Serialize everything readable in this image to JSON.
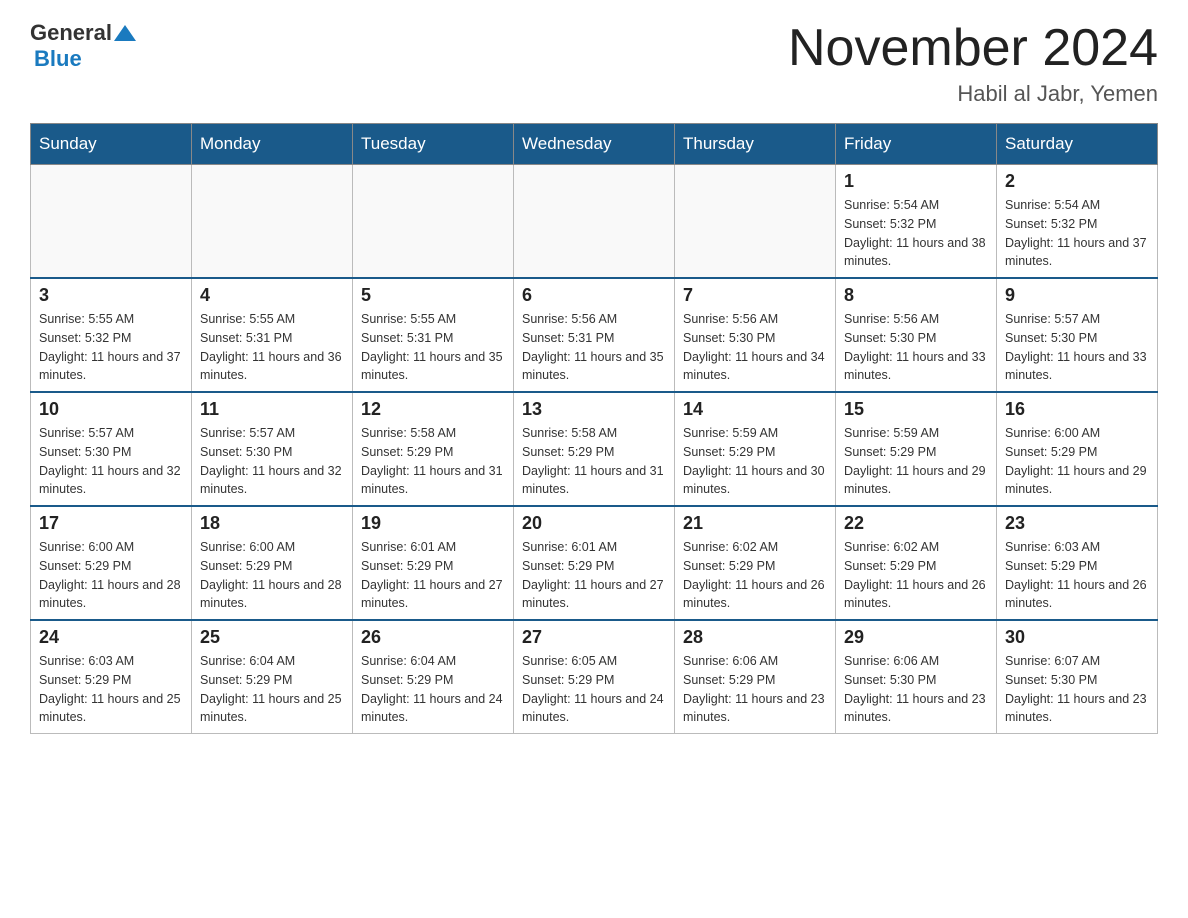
{
  "header": {
    "logo_general": "General",
    "logo_blue": "Blue",
    "month_title": "November 2024",
    "location": "Habil al Jabr, Yemen"
  },
  "weekdays": [
    "Sunday",
    "Monday",
    "Tuesday",
    "Wednesday",
    "Thursday",
    "Friday",
    "Saturday"
  ],
  "weeks": [
    [
      {
        "day": "",
        "sunrise": "",
        "sunset": "",
        "daylight": ""
      },
      {
        "day": "",
        "sunrise": "",
        "sunset": "",
        "daylight": ""
      },
      {
        "day": "",
        "sunrise": "",
        "sunset": "",
        "daylight": ""
      },
      {
        "day": "",
        "sunrise": "",
        "sunset": "",
        "daylight": ""
      },
      {
        "day": "",
        "sunrise": "",
        "sunset": "",
        "daylight": ""
      },
      {
        "day": "1",
        "sunrise": "Sunrise: 5:54 AM",
        "sunset": "Sunset: 5:32 PM",
        "daylight": "Daylight: 11 hours and 38 minutes."
      },
      {
        "day": "2",
        "sunrise": "Sunrise: 5:54 AM",
        "sunset": "Sunset: 5:32 PM",
        "daylight": "Daylight: 11 hours and 37 minutes."
      }
    ],
    [
      {
        "day": "3",
        "sunrise": "Sunrise: 5:55 AM",
        "sunset": "Sunset: 5:32 PM",
        "daylight": "Daylight: 11 hours and 37 minutes."
      },
      {
        "day": "4",
        "sunrise": "Sunrise: 5:55 AM",
        "sunset": "Sunset: 5:31 PM",
        "daylight": "Daylight: 11 hours and 36 minutes."
      },
      {
        "day": "5",
        "sunrise": "Sunrise: 5:55 AM",
        "sunset": "Sunset: 5:31 PM",
        "daylight": "Daylight: 11 hours and 35 minutes."
      },
      {
        "day": "6",
        "sunrise": "Sunrise: 5:56 AM",
        "sunset": "Sunset: 5:31 PM",
        "daylight": "Daylight: 11 hours and 35 minutes."
      },
      {
        "day": "7",
        "sunrise": "Sunrise: 5:56 AM",
        "sunset": "Sunset: 5:30 PM",
        "daylight": "Daylight: 11 hours and 34 minutes."
      },
      {
        "day": "8",
        "sunrise": "Sunrise: 5:56 AM",
        "sunset": "Sunset: 5:30 PM",
        "daylight": "Daylight: 11 hours and 33 minutes."
      },
      {
        "day": "9",
        "sunrise": "Sunrise: 5:57 AM",
        "sunset": "Sunset: 5:30 PM",
        "daylight": "Daylight: 11 hours and 33 minutes."
      }
    ],
    [
      {
        "day": "10",
        "sunrise": "Sunrise: 5:57 AM",
        "sunset": "Sunset: 5:30 PM",
        "daylight": "Daylight: 11 hours and 32 minutes."
      },
      {
        "day": "11",
        "sunrise": "Sunrise: 5:57 AM",
        "sunset": "Sunset: 5:30 PM",
        "daylight": "Daylight: 11 hours and 32 minutes."
      },
      {
        "day": "12",
        "sunrise": "Sunrise: 5:58 AM",
        "sunset": "Sunset: 5:29 PM",
        "daylight": "Daylight: 11 hours and 31 minutes."
      },
      {
        "day": "13",
        "sunrise": "Sunrise: 5:58 AM",
        "sunset": "Sunset: 5:29 PM",
        "daylight": "Daylight: 11 hours and 31 minutes."
      },
      {
        "day": "14",
        "sunrise": "Sunrise: 5:59 AM",
        "sunset": "Sunset: 5:29 PM",
        "daylight": "Daylight: 11 hours and 30 minutes."
      },
      {
        "day": "15",
        "sunrise": "Sunrise: 5:59 AM",
        "sunset": "Sunset: 5:29 PM",
        "daylight": "Daylight: 11 hours and 29 minutes."
      },
      {
        "day": "16",
        "sunrise": "Sunrise: 6:00 AM",
        "sunset": "Sunset: 5:29 PM",
        "daylight": "Daylight: 11 hours and 29 minutes."
      }
    ],
    [
      {
        "day": "17",
        "sunrise": "Sunrise: 6:00 AM",
        "sunset": "Sunset: 5:29 PM",
        "daylight": "Daylight: 11 hours and 28 minutes."
      },
      {
        "day": "18",
        "sunrise": "Sunrise: 6:00 AM",
        "sunset": "Sunset: 5:29 PM",
        "daylight": "Daylight: 11 hours and 28 minutes."
      },
      {
        "day": "19",
        "sunrise": "Sunrise: 6:01 AM",
        "sunset": "Sunset: 5:29 PM",
        "daylight": "Daylight: 11 hours and 27 minutes."
      },
      {
        "day": "20",
        "sunrise": "Sunrise: 6:01 AM",
        "sunset": "Sunset: 5:29 PM",
        "daylight": "Daylight: 11 hours and 27 minutes."
      },
      {
        "day": "21",
        "sunrise": "Sunrise: 6:02 AM",
        "sunset": "Sunset: 5:29 PM",
        "daylight": "Daylight: 11 hours and 26 minutes."
      },
      {
        "day": "22",
        "sunrise": "Sunrise: 6:02 AM",
        "sunset": "Sunset: 5:29 PM",
        "daylight": "Daylight: 11 hours and 26 minutes."
      },
      {
        "day": "23",
        "sunrise": "Sunrise: 6:03 AM",
        "sunset": "Sunset: 5:29 PM",
        "daylight": "Daylight: 11 hours and 26 minutes."
      }
    ],
    [
      {
        "day": "24",
        "sunrise": "Sunrise: 6:03 AM",
        "sunset": "Sunset: 5:29 PM",
        "daylight": "Daylight: 11 hours and 25 minutes."
      },
      {
        "day": "25",
        "sunrise": "Sunrise: 6:04 AM",
        "sunset": "Sunset: 5:29 PM",
        "daylight": "Daylight: 11 hours and 25 minutes."
      },
      {
        "day": "26",
        "sunrise": "Sunrise: 6:04 AM",
        "sunset": "Sunset: 5:29 PM",
        "daylight": "Daylight: 11 hours and 24 minutes."
      },
      {
        "day": "27",
        "sunrise": "Sunrise: 6:05 AM",
        "sunset": "Sunset: 5:29 PM",
        "daylight": "Daylight: 11 hours and 24 minutes."
      },
      {
        "day": "28",
        "sunrise": "Sunrise: 6:06 AM",
        "sunset": "Sunset: 5:29 PM",
        "daylight": "Daylight: 11 hours and 23 minutes."
      },
      {
        "day": "29",
        "sunrise": "Sunrise: 6:06 AM",
        "sunset": "Sunset: 5:30 PM",
        "daylight": "Daylight: 11 hours and 23 minutes."
      },
      {
        "day": "30",
        "sunrise": "Sunrise: 6:07 AM",
        "sunset": "Sunset: 5:30 PM",
        "daylight": "Daylight: 11 hours and 23 minutes."
      }
    ]
  ]
}
